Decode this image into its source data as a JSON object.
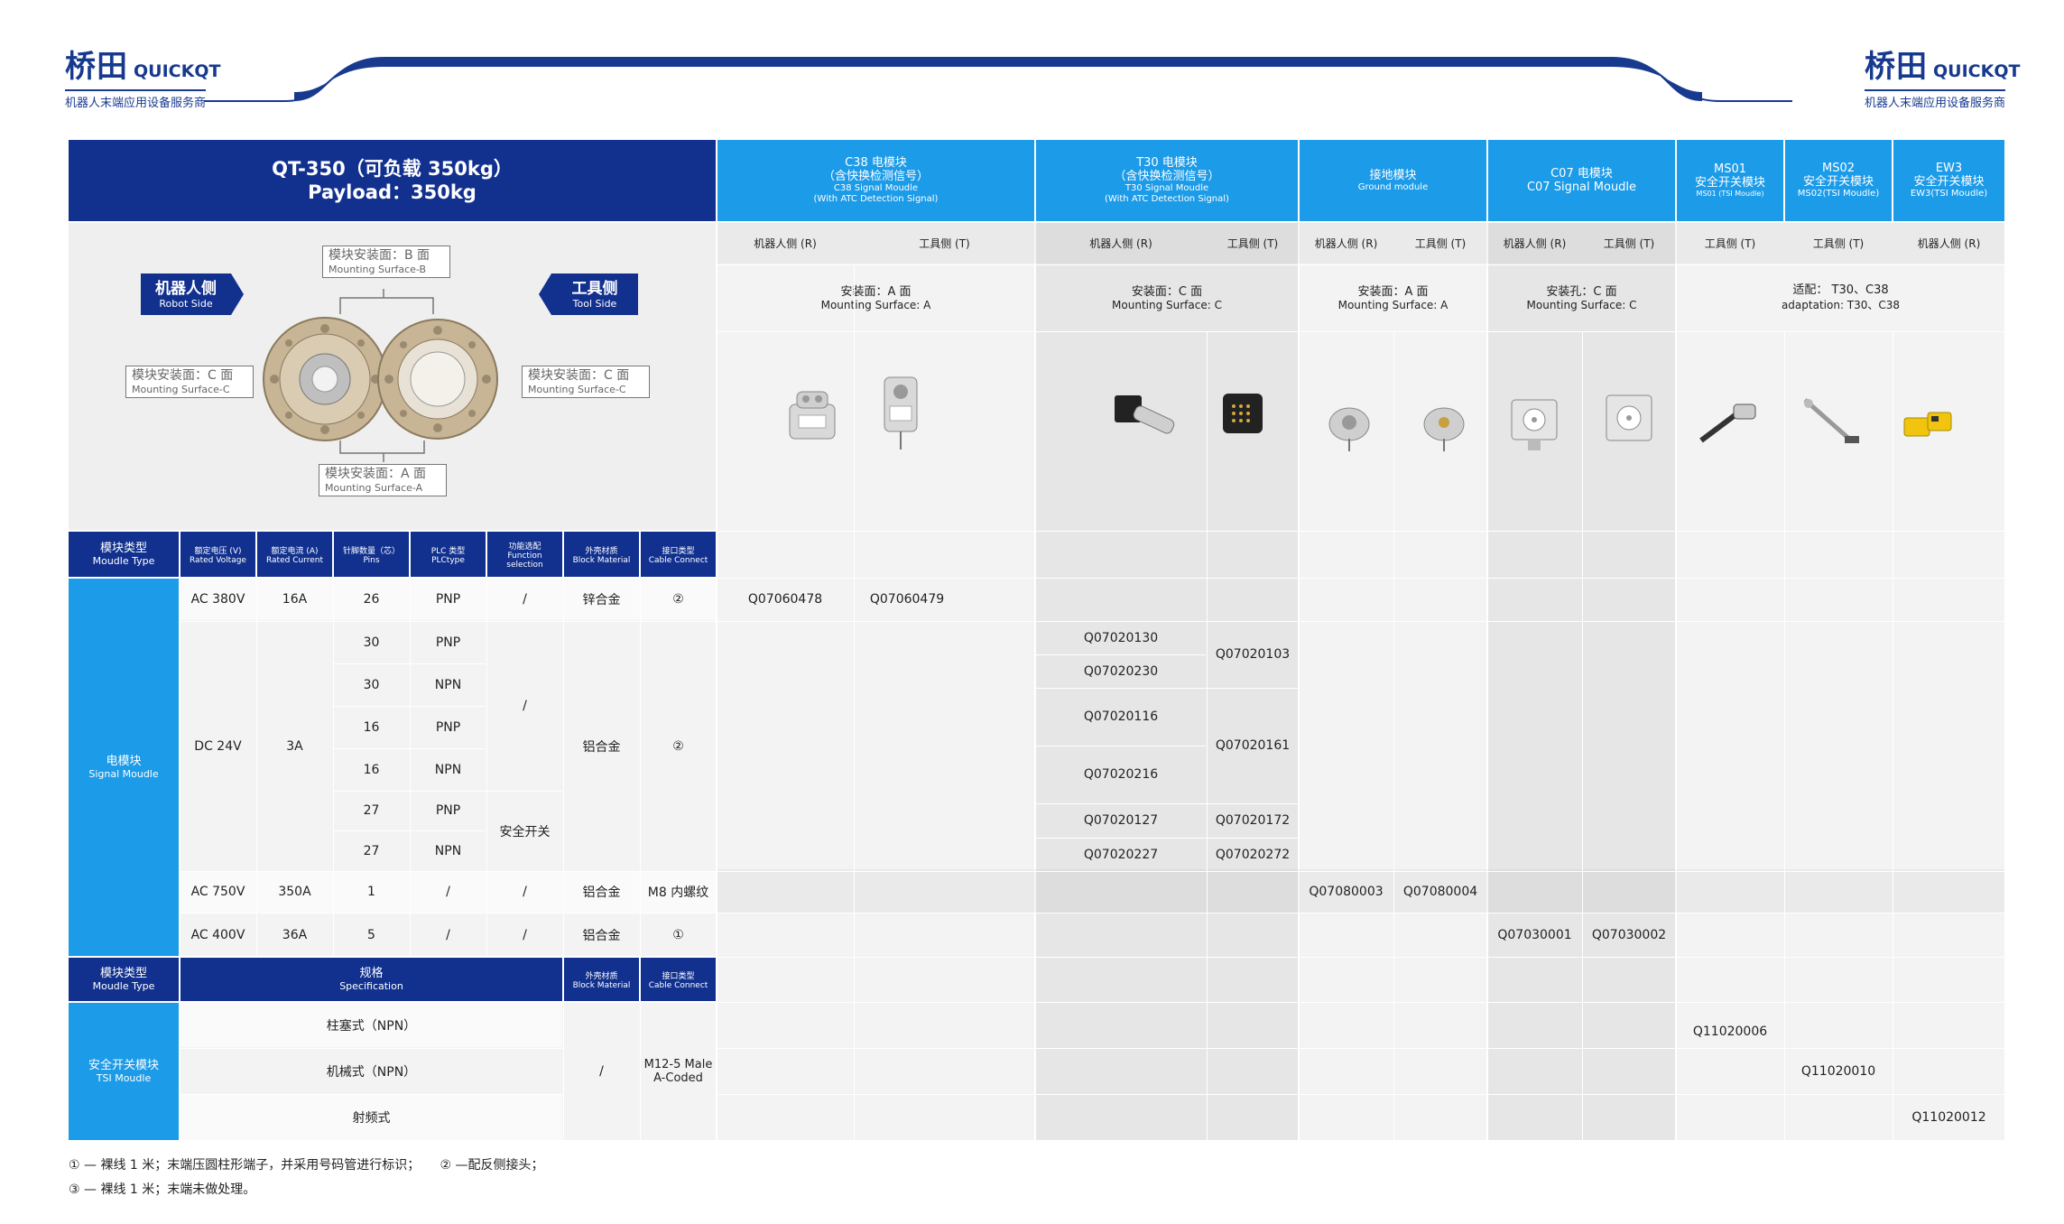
{
  "header": {
    "brand_cn": "桥田",
    "brand_en": "QUICKQT",
    "tagline": "机器人末端应用设备服务商"
  },
  "product": {
    "title_cn": "QT-350（可负载 350kg）",
    "title_en": "Payload：350kg"
  },
  "diagram": {
    "robot_side_cn": "机器人侧",
    "robot_side_en": "Robot Side",
    "tool_side_cn": "工具侧",
    "tool_side_en": "Tool Side",
    "surface_b_cn": "模块安装面：B 面",
    "surface_b_en": "Mounting Surface-B",
    "surface_c_cn": "模块安装面：C 面",
    "surface_c_en": "Mounting Surface-C",
    "surface_a_cn": "模块安装面：A 面",
    "surface_a_en": "Mounting Surface-A"
  },
  "modules": [
    {
      "l1": "C38 电模块",
      "l2": "（含快换检测信号）",
      "l3": "C38 Signal Moudle",
      "l4": "(With ATC Detection Signal)"
    },
    {
      "l1": "T30 电模块",
      "l2": "（含快换检测信号）",
      "l3": "T30 Signal Moudle",
      "l4": "(With ATC Detection  Signal)"
    },
    {
      "l1": "接地模块",
      "l2": "Ground module"
    },
    {
      "l1": "C07 电模块",
      "l2": "C07 Signal Moudle"
    },
    {
      "l1": "MS01",
      "l2": "安全开关模块",
      "l3": "MS01 (TSI Moudle)"
    },
    {
      "l1": "MS02",
      "l2": "安全开关模块",
      "l3": "MS02(TSI Moudle)"
    },
    {
      "l1": "EW3",
      "l2": "安全开关模块",
      "l3": "EW3(TSI Moudle)"
    }
  ],
  "sides": {
    "robot": "机器人侧 (R)",
    "tool": "工具侧 (T)",
    "tool_spaced": "工具侧   (T)"
  },
  "mounting": [
    {
      "cn": "安装面：A 面",
      "en": "Mounting Surface: A"
    },
    {
      "cn": "安装面：C 面",
      "en": "Mounting Surface: C"
    },
    {
      "cn": "安装面：A 面",
      "en": "Mounting Surface: A"
    },
    {
      "cn": "安装孔：C 面",
      "en": "Mounting Surface: C"
    },
    {
      "cn": "适配：  T30、C38",
      "en": "adaptation: T30、C38"
    }
  ],
  "spec_header": {
    "type_cn": "模块类型",
    "type_en": "Moudle Type",
    "voltage_cn": "额定电压 (V)",
    "voltage_en": "Rated Voltage",
    "current_cn": "额定电流 (A)",
    "current_en": "Rated Current",
    "pins_cn": "针脚数量（芯）",
    "pins_en": "Pins",
    "plc_cn": "PLC 类型",
    "plc_en": "PLCtype",
    "func_cn": "功能选配",
    "func_en1": "Function",
    "func_en2": "selection",
    "mat_cn": "外壳材质",
    "mat_en": "Block Material",
    "cable_cn": "接口类型",
    "cable_en": "Cable Connect"
  },
  "signal_module": {
    "cn": "电模块",
    "en": "Signal Moudle",
    "rows": [
      {
        "v": "AC 380V",
        "a": "16A",
        "pins": "26",
        "plc": "PNP",
        "func": "/",
        "mat": "锌合金",
        "cable": "②",
        "c38r": "Q07060478",
        "c38t": "Q07060479"
      },
      {
        "v": "DC 24V",
        "a": "3A",
        "mat": "铝合金",
        "cable": "②"
      },
      {
        "v": "AC 750V",
        "a": "350A",
        "pins": "1",
        "plc": "/",
        "func": "/",
        "mat": "铝合金",
        "cable": "M8 内螺纹",
        "gr": "Q07080003",
        "gt": "Q07080004"
      },
      {
        "v": "AC 400V",
        "a": "36A",
        "pins": "5",
        "plc": "/",
        "func": "/",
        "mat": "铝合金",
        "cable": "①",
        "c07r": "Q07030001",
        "c07t": "Q07030002"
      }
    ],
    "dc_sub": [
      {
        "pins": "30",
        "plc": "PNP"
      },
      {
        "pins": "30",
        "plc": "NPN"
      },
      {
        "pins": "16",
        "plc": "PNP"
      },
      {
        "pins": "16",
        "plc": "NPN"
      },
      {
        "pins": "27",
        "plc": "PNP"
      },
      {
        "pins": "27",
        "plc": "NPN"
      }
    ],
    "dc_func_top": "/",
    "dc_func_bottom": "安全开关",
    "t30_robot": [
      "Q07020130",
      "Q07020230",
      "Q07020116",
      "Q07020216",
      "Q07020127",
      "Q07020227"
    ],
    "t30_tool": [
      "Q07020103",
      "Q07020161",
      "Q07020172",
      "Q07020272"
    ]
  },
  "tsi_header": {
    "type_cn": "模块类型",
    "type_en": "Moudle Type",
    "spec_cn": "规格",
    "spec_en": "Specification",
    "mat_cn": "外壳材质",
    "mat_en": "Block Material",
    "cable_cn": "接口类型",
    "cable_en": "Cable Connect"
  },
  "tsi_module": {
    "cn": "安全开关模块",
    "en": "TSI Moudle",
    "specs": [
      "柱塞式（NPN）",
      "机械式（NPN）",
      "射频式"
    ],
    "material": "/",
    "cable_l1": "M12-5 Male",
    "cable_l2": "A-Coded",
    "codes": [
      "Q11020006",
      "Q11020010",
      "Q11020012"
    ]
  },
  "footnotes": {
    "line1": "① — 裸线 1 米；末端压圆柱形端子，并采用号码管进行标识；     ② —配反侧接头；",
    "line2": "③ — 裸线 1 米；末端未做处理。"
  },
  "colors": {
    "navy": "#12318f",
    "sky": "#1c9be8",
    "grey": "#efefef"
  }
}
